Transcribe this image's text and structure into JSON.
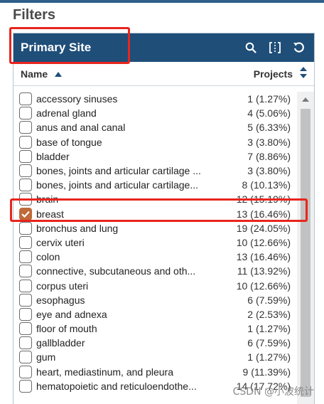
{
  "filters_title": "Filters",
  "panel": {
    "title": "Primary Site",
    "header_icons": [
      "search-icon",
      "column-toggle-icon",
      "reset-icon"
    ],
    "columns": {
      "name": "Name",
      "projects": "Projects"
    },
    "rows": [
      {
        "label": "accessory sinuses",
        "count": "1 (1.27%)",
        "checked": false
      },
      {
        "label": "adrenal gland",
        "count": "4 (5.06%)",
        "checked": false
      },
      {
        "label": "anus and anal canal",
        "count": "5 (6.33%)",
        "checked": false
      },
      {
        "label": "base of tongue",
        "count": "3 (3.80%)",
        "checked": false
      },
      {
        "label": "bladder",
        "count": "7 (8.86%)",
        "checked": false
      },
      {
        "label": "bones, joints and articular cartilage ...",
        "count": "3 (3.80%)",
        "checked": false
      },
      {
        "label": "bones, joints and articular cartilage...",
        "count": "8 (10.13%)",
        "checked": false
      },
      {
        "label": "brain",
        "count": "12 (15.19%)",
        "checked": false
      },
      {
        "label": "breast",
        "count": "13 (16.46%)",
        "checked": true
      },
      {
        "label": "bronchus and lung",
        "count": "19 (24.05%)",
        "checked": false
      },
      {
        "label": "cervix uteri",
        "count": "10 (12.66%)",
        "checked": false
      },
      {
        "label": "colon",
        "count": "13 (16.46%)",
        "checked": false
      },
      {
        "label": "connective, subcutaneous and oth...",
        "count": "11 (13.92%)",
        "checked": false
      },
      {
        "label": "corpus uteri",
        "count": "10 (12.66%)",
        "checked": false
      },
      {
        "label": "esophagus",
        "count": "6 (7.59%)",
        "checked": false
      },
      {
        "label": "eye and adnexa",
        "count": "2 (2.53%)",
        "checked": false
      },
      {
        "label": "floor of mouth",
        "count": "1 (1.27%)",
        "checked": false
      },
      {
        "label": "gallbladder",
        "count": "6 (7.59%)",
        "checked": false
      },
      {
        "label": "gum",
        "count": "1 (1.27%)",
        "checked": false
      },
      {
        "label": "heart, mediastinum, and pleura",
        "count": "9 (11.39%)",
        "checked": false
      },
      {
        "label": "hematopoietic and reticuloendothe...",
        "count": "14 (17.72%)",
        "checked": false
      }
    ]
  },
  "colors": {
    "header_bg": "#1f4e79",
    "checked": "#c0693a",
    "highlight": "#e8251d"
  },
  "watermark": "CSDN @小波统计"
}
